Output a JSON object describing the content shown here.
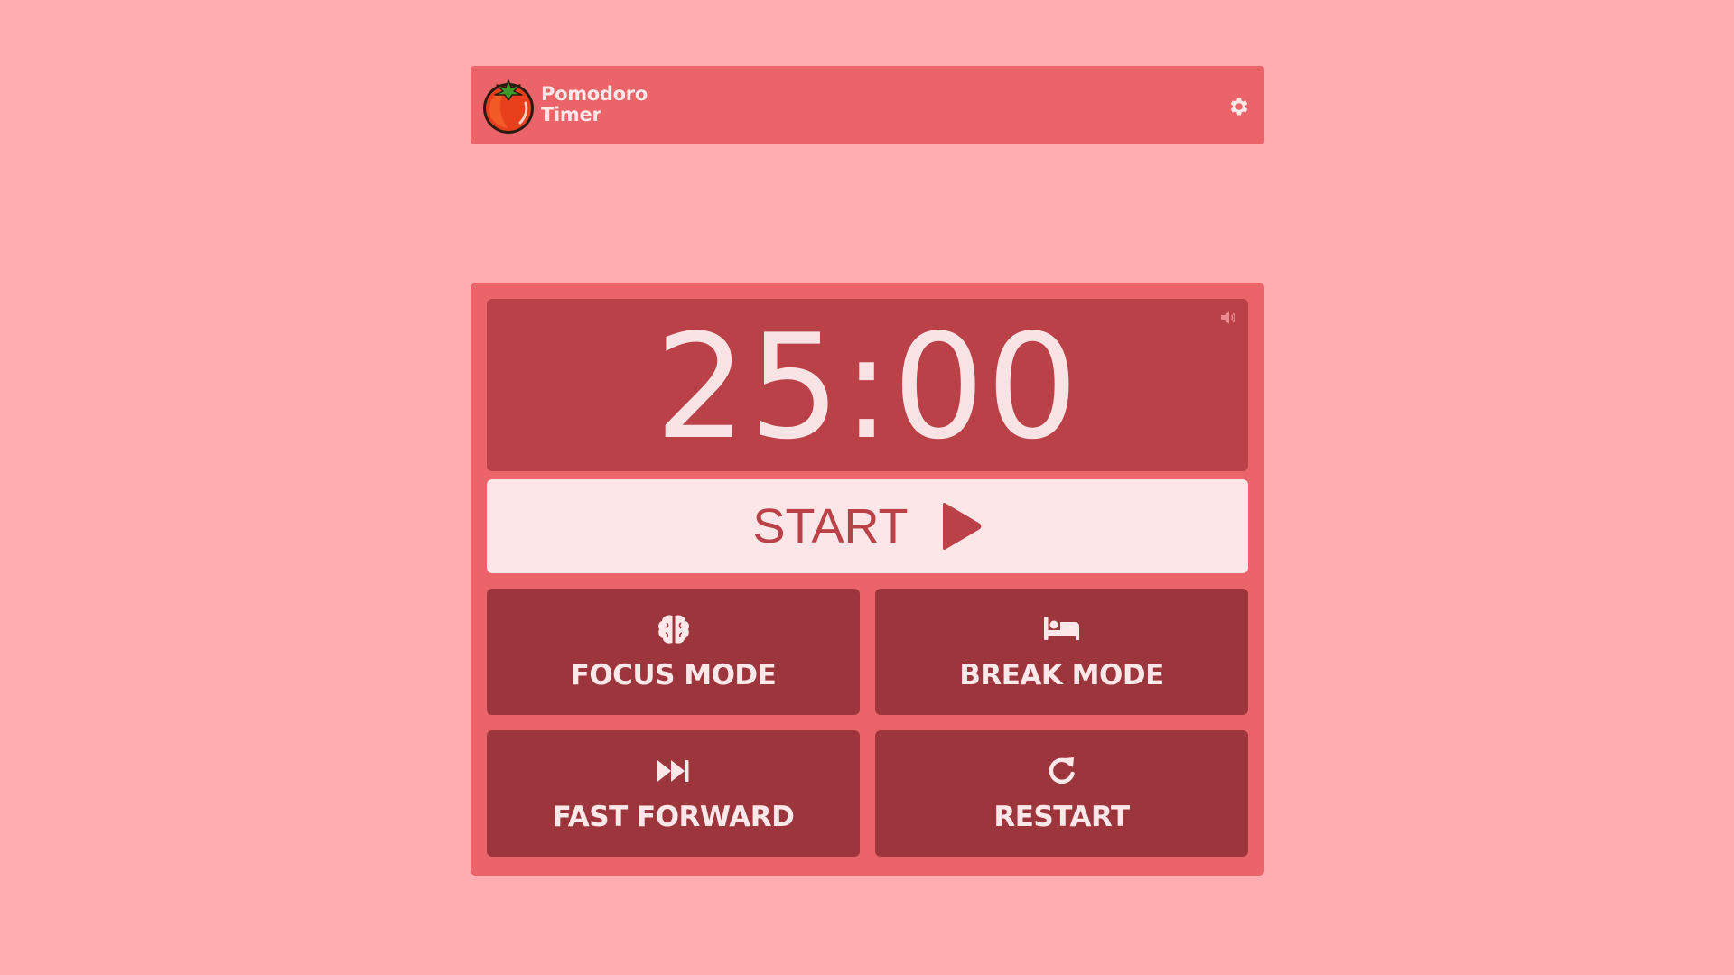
{
  "app": {
    "title_line1": "Pomodoro",
    "title_line2": "Timer"
  },
  "timer": {
    "display": "25:00"
  },
  "controls": {
    "start_label": "START",
    "focus_label": "FOCUS MODE",
    "break_label": "BREAK MODE",
    "fast_forward_label": "FAST FORWARD",
    "restart_label": "RESTART"
  },
  "icons": {
    "logo": "tomato-icon",
    "settings": "gear-icon",
    "sound": "volume-icon",
    "start": "play-icon",
    "focus": "brain-icon",
    "break": "bed-icon",
    "fast_forward": "fast-forward-icon",
    "restart": "restart-icon"
  },
  "colors": {
    "background": "#ffadb0",
    "panel": "#eb6469",
    "display": "#ba4148",
    "button": "#9d363c",
    "start_button": "#fde6e7",
    "text_light": "#fde8e9"
  }
}
